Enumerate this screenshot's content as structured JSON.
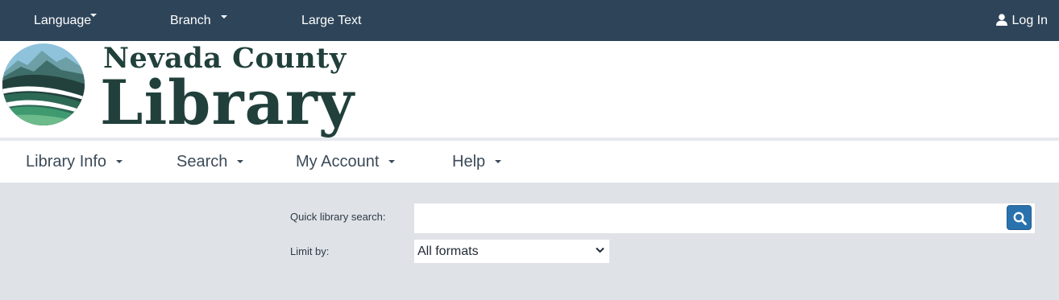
{
  "topbar": {
    "language_label": "Language",
    "branch_label": "Branch",
    "large_text_label": "Large Text",
    "login_label": "Log In"
  },
  "logo": {
    "line1": "Nevada County",
    "line2": "Library"
  },
  "nav": {
    "items": [
      {
        "label": "Library Info"
      },
      {
        "label": "Search"
      },
      {
        "label": "My Account"
      },
      {
        "label": "Help"
      }
    ]
  },
  "search": {
    "quick_label": "Quick library search:",
    "query_value": "",
    "limit_label": "Limit by:",
    "format_selected": "All formats"
  },
  "colors": {
    "topbar_bg": "#2e4459",
    "search_area_bg": "#dfe3e7",
    "search_button_bg": "#2a72ad",
    "logo_text": "#21403b"
  }
}
